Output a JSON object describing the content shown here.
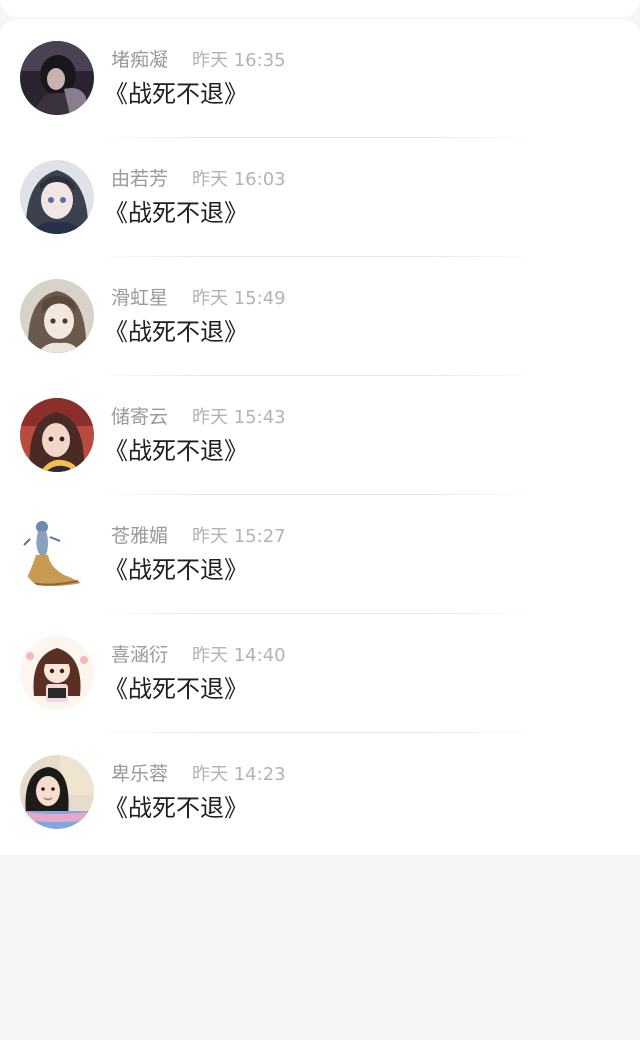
{
  "comments": [
    {
      "name": "堵痴凝",
      "time": "昨天 16:35",
      "content": "《战死不退》",
      "avatar": "avatar-dark-figure"
    },
    {
      "name": "由若芳",
      "time": "昨天 16:03",
      "content": "《战死不退》",
      "avatar": "avatar-anime-girl-gray"
    },
    {
      "name": "滑虹星",
      "time": "昨天 15:49",
      "content": "《战死不退》",
      "avatar": "avatar-anime-girl-brown"
    },
    {
      "name": "储寄云",
      "time": "昨天 15:43",
      "content": "《战死不退》",
      "avatar": "avatar-anime-red-hair"
    },
    {
      "name": "苍雅媚",
      "time": "昨天 15:27",
      "content": "《战死不退》",
      "avatar": "avatar-dress-figure"
    },
    {
      "name": "喜涵衍",
      "time": "昨天 14:40",
      "content": "《战死不退》",
      "avatar": "avatar-chibi-doll"
    },
    {
      "name": "卑乐蓉",
      "time": "昨天 14:23",
      "content": "《战死不退》",
      "avatar": "avatar-photo-girl"
    }
  ]
}
